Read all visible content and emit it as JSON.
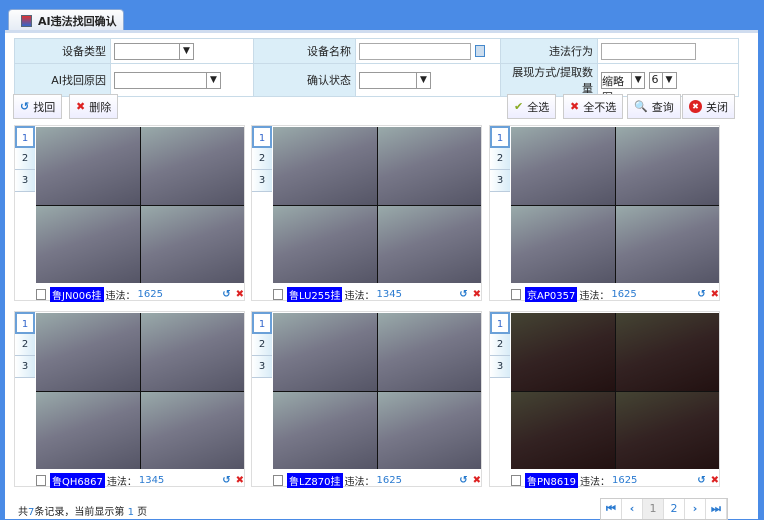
{
  "tab": {
    "title": "AI违法找回确认"
  },
  "filters": {
    "device_type_label": "设备类型",
    "device_name_label": "设备名称",
    "violation_label": "违法行为",
    "ai_reason_label": "AI找回原因",
    "confirm_status_label": "确认状态",
    "display_label": "展现方式/提取数量",
    "display_mode": "缩略图",
    "count": "6"
  },
  "toolbar": {
    "retrieve": "找回",
    "delete": "删除",
    "select_all": "全选",
    "select_none": "全不选",
    "query": "查询",
    "close": "关闭"
  },
  "cards": [
    {
      "plate": "鲁JN006挂",
      "label": "违法：",
      "code": "1625"
    },
    {
      "plate": "鲁LU255挂",
      "label": "违法：",
      "code": "1345"
    },
    {
      "plate": "京AP0357",
      "label": "违法：",
      "code": "1625"
    },
    {
      "plate": "鲁QH6867",
      "label": "违法：",
      "code": "1345"
    },
    {
      "plate": "鲁LZ870挂",
      "label": "违法：",
      "code": "1625"
    },
    {
      "plate": "鲁PN8619",
      "label": "违法：",
      "code": "1625"
    }
  ],
  "image_tabs": [
    "1",
    "2",
    "3"
  ],
  "status": {
    "prefix": "共",
    "total": "7",
    "mid": "条记录，当前显示第",
    "page": "1",
    "suffix": "页"
  },
  "pagination": {
    "pages": [
      "1",
      "2"
    ],
    "current": "1"
  }
}
